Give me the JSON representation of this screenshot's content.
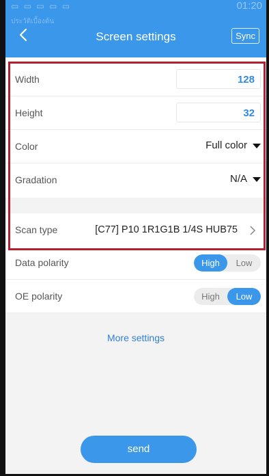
{
  "status_bar": {
    "left_text": "▭ ▭ ▭ ▭ ▭",
    "right_text": "01:20",
    "notification": "ประวัติเบื้องต้น"
  },
  "header": {
    "title": "Screen settings",
    "sync_label": "Sync"
  },
  "settings": {
    "width": {
      "label": "Width",
      "value": "128"
    },
    "height": {
      "label": "Height",
      "value": "32"
    },
    "color": {
      "label": "Color",
      "value": "Full color"
    },
    "gradation": {
      "label": "Gradation",
      "value": "N/A"
    },
    "scan_type": {
      "label": "Scan type",
      "value": "[C77]  P10 1R1G1B 1/4S HUB75"
    },
    "data_polarity": {
      "label": "Data polarity",
      "options": [
        "High",
        "Low"
      ],
      "selected": "High"
    },
    "oe_polarity": {
      "label": "OE polarity",
      "options": [
        "High",
        "Low"
      ],
      "selected": "Low"
    }
  },
  "more_settings_label": "More settings",
  "send_label": "send",
  "colors": {
    "accent": "#3b97ea",
    "highlight_border": "#b0202e"
  }
}
